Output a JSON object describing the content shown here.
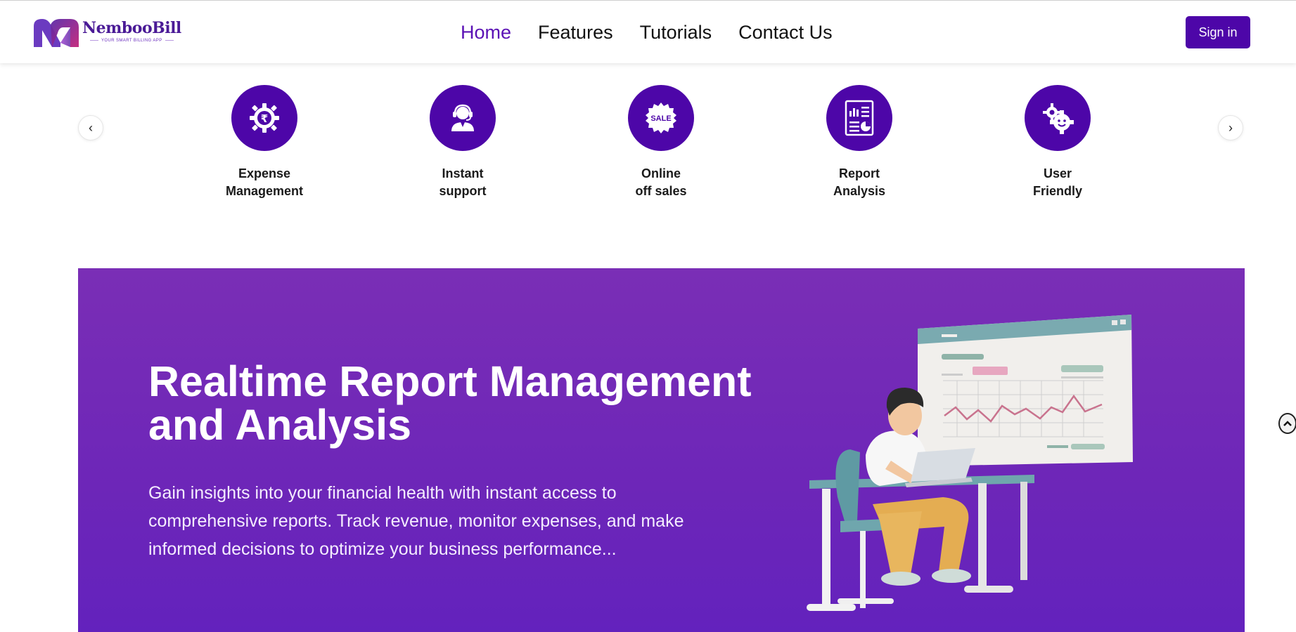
{
  "brand": {
    "name": "NembooBill",
    "tagline": "YOUR SMART BILLING APP"
  },
  "nav": {
    "items": [
      {
        "label": "Home",
        "active": true
      },
      {
        "label": "Features",
        "active": false
      },
      {
        "label": "Tutorials",
        "active": false
      },
      {
        "label": "Contact Us",
        "active": false
      }
    ],
    "sign_in_label": "Sign in"
  },
  "features": {
    "prev_icon": "chevron-left-icon",
    "next_icon": "chevron-right-icon",
    "items": [
      {
        "label": "Expense\nManagement",
        "icon": "rupee-gear-icon"
      },
      {
        "label": "Instant\nsupport",
        "icon": "support-agent-icon"
      },
      {
        "label": "Online\noff sales",
        "icon": "sale-badge-icon",
        "icon_text": "SALE"
      },
      {
        "label": "Report\nAnalysis",
        "icon": "report-document-icon"
      },
      {
        "label": "User\nFriendly",
        "icon": "gears-smiley-icon"
      }
    ]
  },
  "hero": {
    "title": "Realtime Report Management and Analysis",
    "description": "Gain insights into your financial health with instant access to comprehensive reports. Track revenue, monitor expenses, and make informed decisions to optimize your business performance..."
  },
  "colors": {
    "brand_purple": "#4d06a8",
    "nav_active": "#5b12b5",
    "hero_bg": "#7a2eb6",
    "hero_bg_bottom": "#6322bd"
  }
}
